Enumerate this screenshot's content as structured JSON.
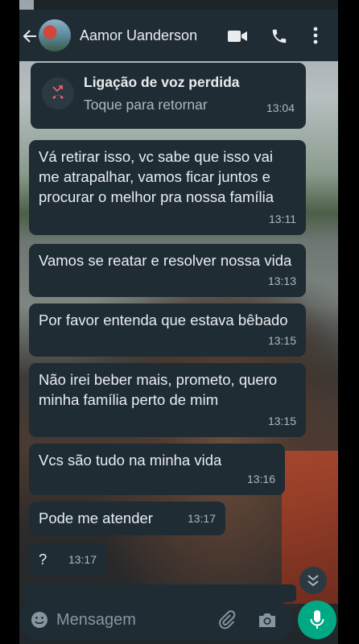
{
  "header": {
    "contact_name": "Aamor Uanderson",
    "icons": {
      "back": "arrow-left",
      "video": "video-camera",
      "call": "phone",
      "menu": "more-vertical"
    }
  },
  "missed_call": {
    "title": "Ligação de voz perdida",
    "subtitle": "Toque para retornar",
    "time": "13:04",
    "icon": "missed-call-arrow",
    "icon_color": "#f15c6d"
  },
  "messages": [
    {
      "text": "Vá retirar isso, vc sabe que isso vai me atrapalhar, vamos ficar juntos e procurar o melhor pra nossa família",
      "time": "13:11"
    },
    {
      "text": "Vamos se reatar e resolver nossa vida",
      "time": "13:13"
    },
    {
      "text": "Por favor entenda que estava bêbado",
      "time": "13:15"
    },
    {
      "text": "Não irei beber mais, prometo, quero minha família perto de mim",
      "time": "13:15"
    },
    {
      "text": "Vcs são tudo na minha vida",
      "time": "13:16"
    },
    {
      "text": "Pode me atender",
      "time": "13:17"
    },
    {
      "text": "?",
      "time": "13:17"
    }
  ],
  "input": {
    "placeholder": "Mensagem",
    "icons": {
      "emoji": "smiley",
      "attach": "paperclip",
      "camera": "camera",
      "send": "microphone"
    }
  },
  "colors": {
    "bubble": "#1f2c34",
    "header": "#1f2c34",
    "text": "#e9edef",
    "meta": "#aeb8bd",
    "accent": "#00a884"
  }
}
